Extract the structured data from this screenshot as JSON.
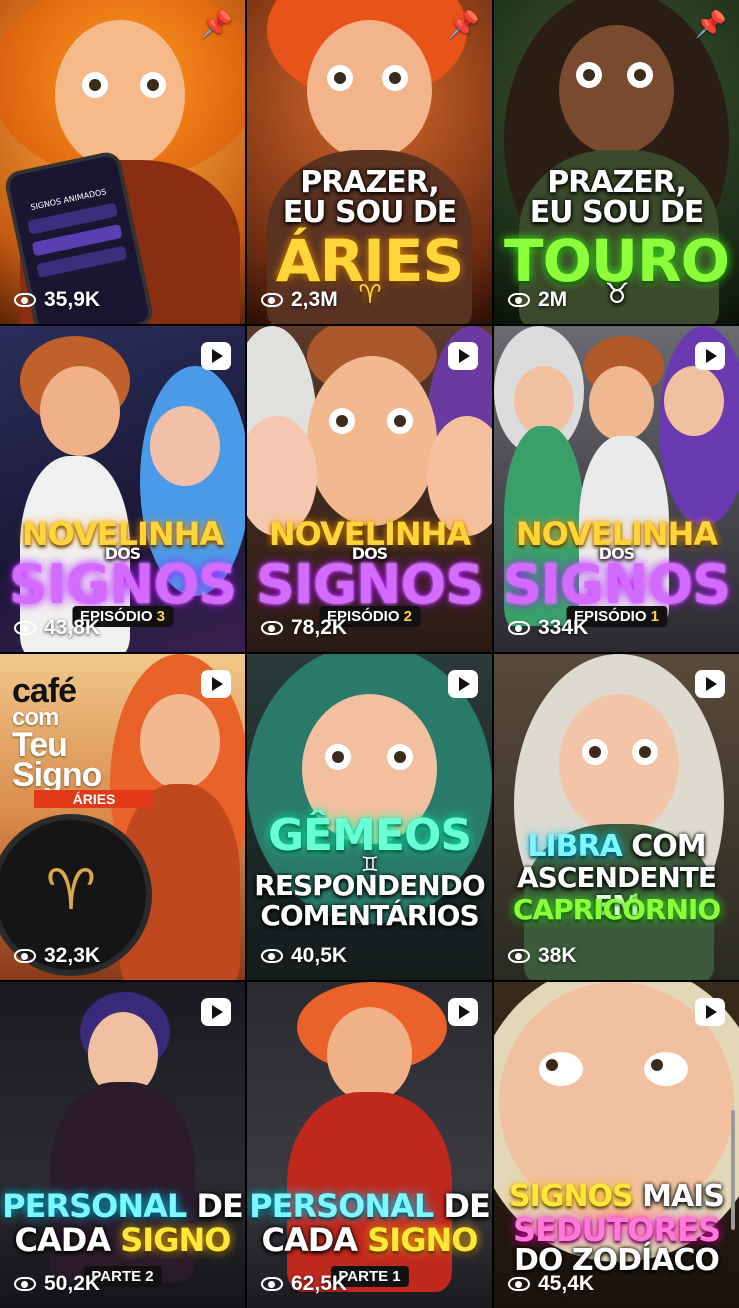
{
  "tiles": [
    {
      "id": "t1",
      "pinned": true,
      "views": "35,9K",
      "phone_title": "SIGNOS ANIMADOS"
    },
    {
      "id": "t2",
      "pinned": true,
      "views": "2,3M",
      "line1": "PRAZER,",
      "line2": "EU SOU DE",
      "big": "ÁRIES",
      "symbol": "♈"
    },
    {
      "id": "t3",
      "pinned": true,
      "views": "2M",
      "line1": "PRAZER,",
      "line2": "EU SOU DE",
      "big": "TOURO",
      "symbol": "♉"
    },
    {
      "id": "t4",
      "views": "43,8K",
      "top": "NOVELINHA",
      "mid": "DOS",
      "big": "SIGNOS",
      "ep_label": "EPISÓDIO",
      "ep_num": "3"
    },
    {
      "id": "t5",
      "views": "78,2K",
      "top": "NOVELINHA",
      "mid": "DOS",
      "big": "SIGNOS",
      "ep_label": "EPISÓDIO",
      "ep_num": "2"
    },
    {
      "id": "t6",
      "views": "334K",
      "top": "NOVELINHA",
      "mid": "DOS",
      "big": "SIGNOS",
      "ep_label": "EPISÓDIO",
      "ep_num": "1"
    },
    {
      "id": "t7",
      "views": "32,3K",
      "cafe": "café",
      "com": "com",
      "teu": "Teu",
      "signo": "Signo",
      "tag": "ÁRIES",
      "symbol": "♈"
    },
    {
      "id": "t8",
      "views": "40,5K",
      "big": "GÊMEOS",
      "symbol": "♊",
      "l2": "RESPONDENDO",
      "l3": "COMENTÁRIOS"
    },
    {
      "id": "t9",
      "views": "38K",
      "a": "LIBRA",
      "b": "COM",
      "c": "ASCENDENTE EM",
      "d": "CAPRICÓRNIO"
    },
    {
      "id": "t10",
      "views": "50,2K",
      "a": "PERSONAL",
      "b": "DE",
      "c": "CADA",
      "d": "SIGNO",
      "part": "PARTE 2"
    },
    {
      "id": "t11",
      "views": "62,5K",
      "a": "PERSONAL",
      "b": "DE",
      "c": "CADA",
      "d": "SIGNO",
      "part": "PARTE 1"
    },
    {
      "id": "t12",
      "views": "45,4K",
      "a": "SIGNOS",
      "b": "MAIS",
      "c": "SEDUTORES",
      "d": "DO ZODÍACO"
    }
  ],
  "colors": {
    "bg": "#000000",
    "accent_gold": "#ffd63a",
    "accent_purple": "#d46bff",
    "accent_green": "#8cff3a"
  }
}
